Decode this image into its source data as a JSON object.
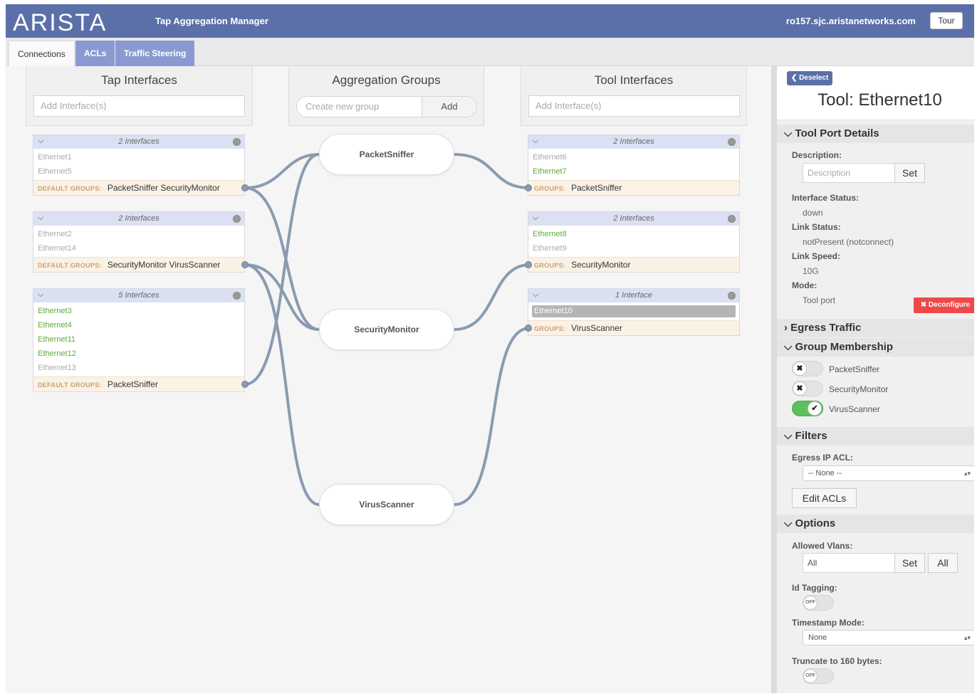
{
  "header": {
    "logo": "ARISTA",
    "app_title": "Tap Aggregation Manager",
    "hostname": "ro157.sjc.aristanetworks.com",
    "tour_label": "Tour"
  },
  "tabs": [
    {
      "label": "Connections",
      "active": true
    },
    {
      "label": "ACLs",
      "active": false
    },
    {
      "label": "Traffic Steering",
      "active": false
    }
  ],
  "tap": {
    "title": "Tap Interfaces",
    "placeholder": "Add Interface(s)",
    "groups": [
      {
        "count": "2 Interfaces",
        "items": [
          "Ethernet1",
          "Ethernet5"
        ],
        "foot_label": "DEFAULT GROUPS:",
        "foot_value": "PacketSniffer  SecurityMonitor"
      },
      {
        "count": "2 Interfaces",
        "items": [
          "Ethernet2",
          "Ethernet14"
        ],
        "foot_label": "DEFAULT GROUPS:",
        "foot_value": "SecurityMonitor  VirusScanner"
      },
      {
        "count": "5 Interfaces",
        "items": [
          "Ethernet3",
          "Ethernet4",
          "Ethernet11",
          "Ethernet12",
          "Ethernet13"
        ],
        "foot_label": "DEFAULT GROUPS:",
        "foot_value": "PacketSniffer"
      }
    ]
  },
  "aggregation": {
    "title": "Aggregation Groups",
    "placeholder": "Create new group",
    "add_label": "Add",
    "groups": [
      "PacketSniffer",
      "SecurityMonitor",
      "VirusScanner"
    ]
  },
  "tool": {
    "title": "Tool Interfaces",
    "placeholder": "Add Interface(s)",
    "groups": [
      {
        "count": "2 Interfaces",
        "items": [
          "Ethernet6",
          "Ethernet7"
        ],
        "foot_label": "GROUPS:",
        "foot_value": "PacketSniffer"
      },
      {
        "count": "2 Interfaces",
        "items": [
          "Ethernet8",
          "Ethernet9"
        ],
        "foot_label": "GROUPS:",
        "foot_value": "SecurityMonitor"
      },
      {
        "count": "1 Interface",
        "items": [
          "Ethernet10"
        ],
        "foot_label": "GROUPS:",
        "foot_value": "VirusScanner"
      }
    ]
  },
  "panel": {
    "deselect_label": "Deselect",
    "title": "Tool: Ethernet10",
    "sections": {
      "port_details": "Tool Port Details",
      "egress": "Egress Traffic",
      "membership": "Group Membership",
      "filters": "Filters",
      "options": "Options"
    },
    "description_label": "Description:",
    "description_placeholder": "Description",
    "set_label": "Set",
    "interface_status_label": "Interface Status:",
    "interface_status": "down",
    "link_status_label": "Link Status:",
    "link_status": "notPresent (notconnect)",
    "link_speed_label": "Link Speed:",
    "link_speed": "10G",
    "mode_label": "Mode:",
    "mode": "Tool port",
    "deconfigure_label": "Deconfigure",
    "membership": [
      {
        "name": "PacketSniffer",
        "member": false
      },
      {
        "name": "SecurityMonitor",
        "member": false
      },
      {
        "name": "VirusScanner",
        "member": true
      }
    ],
    "egress_acl_label": "Egress IP ACL:",
    "egress_acl_value": "-- None --",
    "edit_acls_label": "Edit ACLs",
    "allowed_vlans_label": "Allowed Vlans:",
    "allowed_vlans_value": "All",
    "all_label": "All",
    "id_tagging_label": "Id Tagging:",
    "off_label": "OFF",
    "timestamp_label": "Timestamp Mode:",
    "timestamp_value": "None",
    "truncate_label": "Truncate to 160 bytes:"
  },
  "colors": {
    "header": "#5b6fa8",
    "tab_inactive": "#8a9ad1",
    "link": "#8a9bb0",
    "active_item": "#5aad3a",
    "deconfigure": "#f04848",
    "toggle_on": "#5bbf5b"
  }
}
